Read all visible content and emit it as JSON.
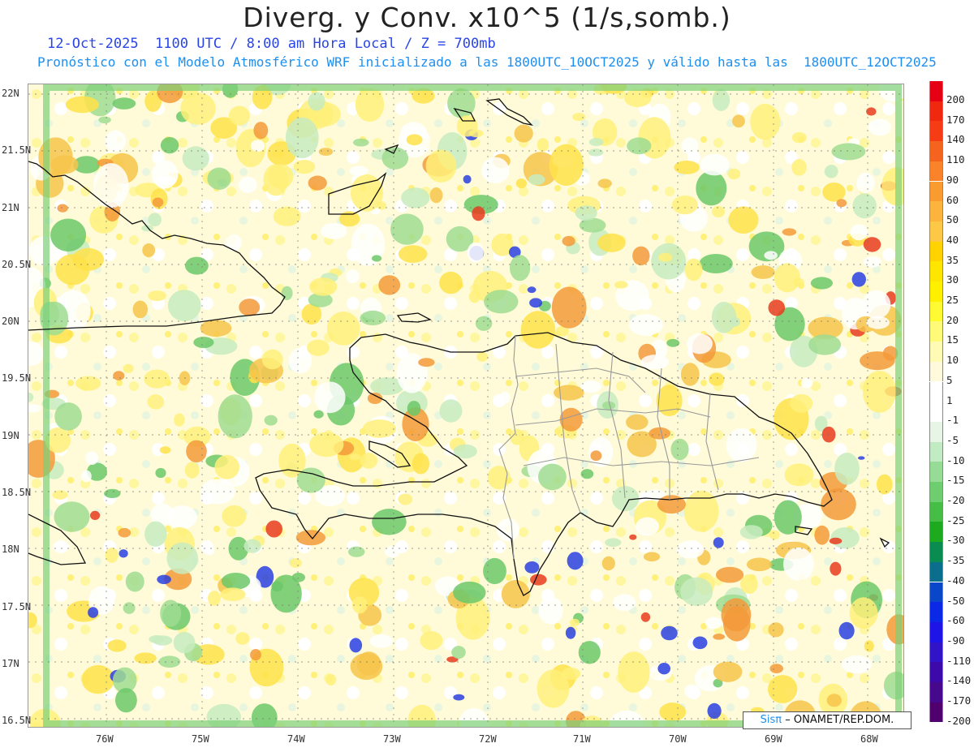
{
  "header": {
    "title": "Diverg. y Conv. x10^5 (1/s,somb.)",
    "line1": "12-Oct-2025  1100 UTC / 8:00 am Hora Local / Z = 700mb",
    "line2": "Pronóstico con el Modelo Atmosférico WRF inicializado a las 1800UTC_10OCT2025 y válido hasta las  1800UTC_12OCT2025"
  },
  "axes": {
    "lat_labels": [
      "22N",
      "21.5N",
      "21N",
      "20.5N",
      "20N",
      "19.5N",
      "19N",
      "18.5N",
      "18N",
      "17.5N",
      "17N",
      "16.5N"
    ],
    "lon_labels": [
      "76W",
      "75W",
      "74W",
      "73W",
      "72W",
      "71W",
      "70W",
      "69W",
      "68W"
    ]
  },
  "colorbar": {
    "labels": [
      "200",
      "170",
      "140",
      "110",
      "90",
      "60",
      "50",
      "40",
      "35",
      "30",
      "25",
      "20",
      "15",
      "10",
      "5",
      "1",
      "-1",
      "-5",
      "-10",
      "-15",
      "-20",
      "-25",
      "-30",
      "-35",
      "-40",
      "-50",
      "-60",
      "-90",
      "-110",
      "-140",
      "-170",
      "-200"
    ],
    "colors": [
      "#e60014",
      "#f0280f",
      "#f53c14",
      "#f5641e",
      "#fa8228",
      "#fa9b32",
      "#fcb43c",
      "#fcc846",
      "#ffd200",
      "#ffe600",
      "#fff000",
      "#fffa32",
      "#fffa78",
      "#fffab4",
      "#fffadc",
      "#ffffff",
      "#ffffff",
      "#e6f5e6",
      "#c3ebc3",
      "#96dc96",
      "#6ecd6e",
      "#46be46",
      "#1eaa1e",
      "#0a8c50",
      "#0a6e8c",
      "#0a46c8",
      "#0a28e6",
      "#1e14e6",
      "#3214c8",
      "#3c0aaa",
      "#46088c",
      "#50006e"
    ]
  },
  "credit": {
    "brand": "Sisπ",
    "text": "– ONAMET/REP.DOM."
  },
  "map": {
    "region": "Hispaniola / Greater Antilles",
    "background": "#fffad0"
  }
}
